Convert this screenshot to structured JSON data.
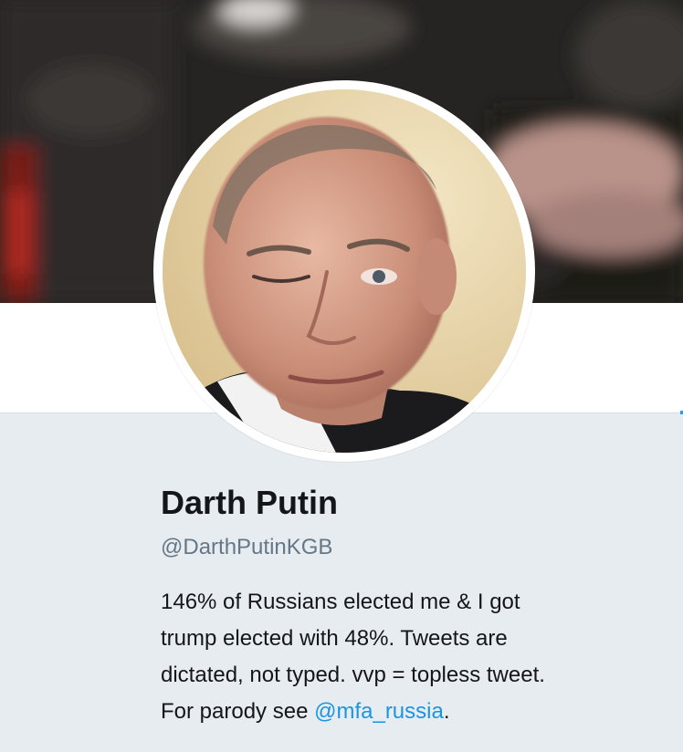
{
  "banner": {
    "image": "blurred-hands-banner"
  },
  "avatar": {
    "image": "profile-photo-winking-man"
  },
  "profile": {
    "display_name": "Darth Putin",
    "handle": "@DarthPutinKGB",
    "bio": {
      "line1": "146% of Russians elected me & I got",
      "line2": "trump elected with 48%. Tweets are",
      "line3": "dictated, not typed. vvp = topless tweet.",
      "line4_prefix": "For parody see ",
      "mention": "@mfa_russia",
      "line4_suffix": "."
    }
  },
  "colors": {
    "background": "#e6ecf0",
    "name": "#14171a",
    "handle": "#657786",
    "link": "#1b95e0",
    "accent": "#1da1f2"
  }
}
